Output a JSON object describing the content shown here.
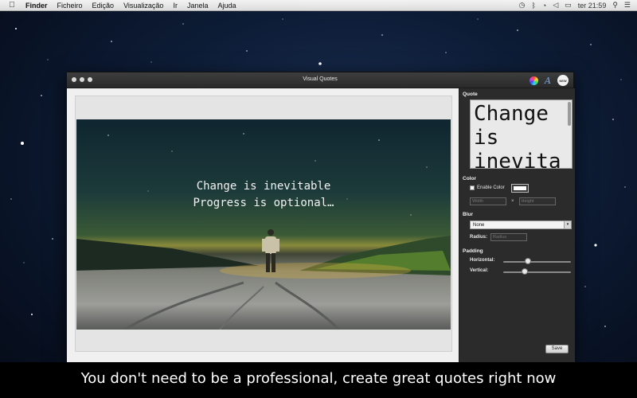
{
  "menubar": {
    "apple": "",
    "items": [
      "Finder",
      "Ficheiro",
      "Edição",
      "Visualização",
      "Ir",
      "Janela",
      "Ajuda"
    ],
    "clock": "ter 21:59"
  },
  "window": {
    "title": "Visual Quotes",
    "new_badge": "NEW"
  },
  "canvas": {
    "quote": "Change is inevitable\nProgress is optional…"
  },
  "inspector": {
    "quote_title": "Quote",
    "quote_text": "Change is inevitable",
    "color_title": "Color",
    "enable_color_label": "Enable Color",
    "width_placeholder": "Width",
    "times": "×",
    "height_placeholder": "Height",
    "blur_title": "Blur",
    "blur_selected": "None",
    "radius_label": "Radius:",
    "radius_placeholder": "Radius",
    "padding_title": "Padding",
    "horizontal_label": "Horizontal:",
    "vertical_label": "Vertical:",
    "horizontal_value": 0.35,
    "vertical_value": 0.3,
    "save_label": "Save"
  },
  "caption": "You don't need to be a professional, create great quotes right now"
}
